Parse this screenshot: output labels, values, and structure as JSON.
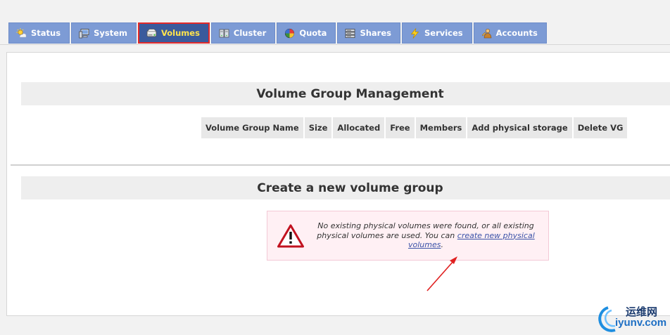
{
  "tabs": [
    {
      "label": "Status",
      "icon": "sun-icon"
    },
    {
      "label": "System",
      "icon": "monitor-icon"
    },
    {
      "label": "Volumes",
      "icon": "drive-icon",
      "active": true
    },
    {
      "label": "Cluster",
      "icon": "cluster-icon"
    },
    {
      "label": "Quota",
      "icon": "pie-chart-icon"
    },
    {
      "label": "Shares",
      "icon": "server-icon"
    },
    {
      "label": "Services",
      "icon": "lightning-icon"
    },
    {
      "label": "Accounts",
      "icon": "user-icon"
    }
  ],
  "vg_section": {
    "title": "Volume Group Management",
    "columns": [
      "Volume Group Name",
      "Size",
      "Allocated",
      "Free",
      "Members",
      "Add physical storage",
      "Delete VG"
    ]
  },
  "create_section": {
    "title": "Create a new volume group",
    "message_text": "No existing physical volumes were found, or all existing physical volumes are used. You can ",
    "link_text": "create new physical volumes",
    "message_end": "."
  },
  "watermark": {
    "chinese": "运维网",
    "url": "iyunv.com"
  },
  "colors": {
    "tab_bg": "#7d9bd5",
    "tab_active_bg": "#3a5a9c",
    "tab_active_text": "#ffe34d",
    "highlight_border": "#e32a2a",
    "notice_bg": "#fff0f4",
    "link": "#3b52a8"
  }
}
